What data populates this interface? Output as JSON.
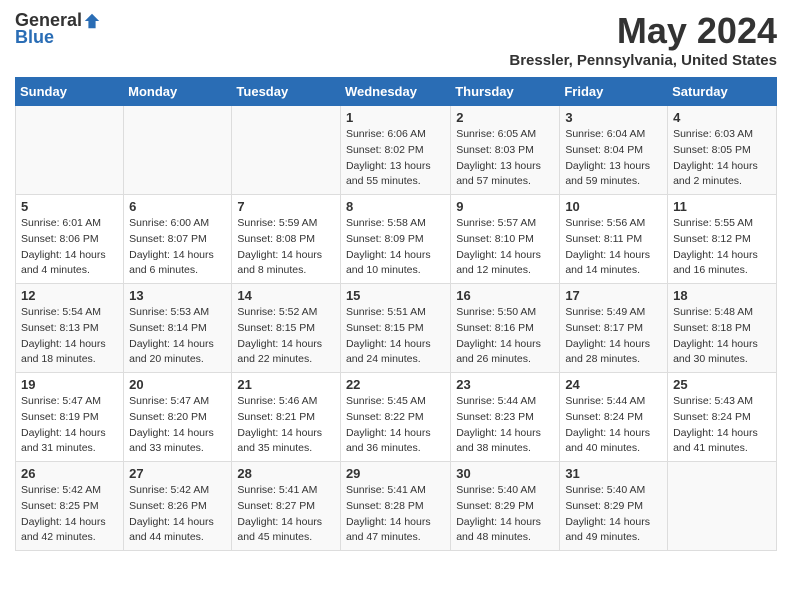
{
  "logo": {
    "general": "General",
    "blue": "Blue"
  },
  "title": "May 2024",
  "location": "Bressler, Pennsylvania, United States",
  "headers": [
    "Sunday",
    "Monday",
    "Tuesday",
    "Wednesday",
    "Thursday",
    "Friday",
    "Saturday"
  ],
  "weeks": [
    [
      {
        "day": "",
        "info": ""
      },
      {
        "day": "",
        "info": ""
      },
      {
        "day": "",
        "info": ""
      },
      {
        "day": "1",
        "info": "Sunrise: 6:06 AM\nSunset: 8:02 PM\nDaylight: 13 hours\nand 55 minutes."
      },
      {
        "day": "2",
        "info": "Sunrise: 6:05 AM\nSunset: 8:03 PM\nDaylight: 13 hours\nand 57 minutes."
      },
      {
        "day": "3",
        "info": "Sunrise: 6:04 AM\nSunset: 8:04 PM\nDaylight: 13 hours\nand 59 minutes."
      },
      {
        "day": "4",
        "info": "Sunrise: 6:03 AM\nSunset: 8:05 PM\nDaylight: 14 hours\nand 2 minutes."
      }
    ],
    [
      {
        "day": "5",
        "info": "Sunrise: 6:01 AM\nSunset: 8:06 PM\nDaylight: 14 hours\nand 4 minutes."
      },
      {
        "day": "6",
        "info": "Sunrise: 6:00 AM\nSunset: 8:07 PM\nDaylight: 14 hours\nand 6 minutes."
      },
      {
        "day": "7",
        "info": "Sunrise: 5:59 AM\nSunset: 8:08 PM\nDaylight: 14 hours\nand 8 minutes."
      },
      {
        "day": "8",
        "info": "Sunrise: 5:58 AM\nSunset: 8:09 PM\nDaylight: 14 hours\nand 10 minutes."
      },
      {
        "day": "9",
        "info": "Sunrise: 5:57 AM\nSunset: 8:10 PM\nDaylight: 14 hours\nand 12 minutes."
      },
      {
        "day": "10",
        "info": "Sunrise: 5:56 AM\nSunset: 8:11 PM\nDaylight: 14 hours\nand 14 minutes."
      },
      {
        "day": "11",
        "info": "Sunrise: 5:55 AM\nSunset: 8:12 PM\nDaylight: 14 hours\nand 16 minutes."
      }
    ],
    [
      {
        "day": "12",
        "info": "Sunrise: 5:54 AM\nSunset: 8:13 PM\nDaylight: 14 hours\nand 18 minutes."
      },
      {
        "day": "13",
        "info": "Sunrise: 5:53 AM\nSunset: 8:14 PM\nDaylight: 14 hours\nand 20 minutes."
      },
      {
        "day": "14",
        "info": "Sunrise: 5:52 AM\nSunset: 8:15 PM\nDaylight: 14 hours\nand 22 minutes."
      },
      {
        "day": "15",
        "info": "Sunrise: 5:51 AM\nSunset: 8:15 PM\nDaylight: 14 hours\nand 24 minutes."
      },
      {
        "day": "16",
        "info": "Sunrise: 5:50 AM\nSunset: 8:16 PM\nDaylight: 14 hours\nand 26 minutes."
      },
      {
        "day": "17",
        "info": "Sunrise: 5:49 AM\nSunset: 8:17 PM\nDaylight: 14 hours\nand 28 minutes."
      },
      {
        "day": "18",
        "info": "Sunrise: 5:48 AM\nSunset: 8:18 PM\nDaylight: 14 hours\nand 30 minutes."
      }
    ],
    [
      {
        "day": "19",
        "info": "Sunrise: 5:47 AM\nSunset: 8:19 PM\nDaylight: 14 hours\nand 31 minutes."
      },
      {
        "day": "20",
        "info": "Sunrise: 5:47 AM\nSunset: 8:20 PM\nDaylight: 14 hours\nand 33 minutes."
      },
      {
        "day": "21",
        "info": "Sunrise: 5:46 AM\nSunset: 8:21 PM\nDaylight: 14 hours\nand 35 minutes."
      },
      {
        "day": "22",
        "info": "Sunrise: 5:45 AM\nSunset: 8:22 PM\nDaylight: 14 hours\nand 36 minutes."
      },
      {
        "day": "23",
        "info": "Sunrise: 5:44 AM\nSunset: 8:23 PM\nDaylight: 14 hours\nand 38 minutes."
      },
      {
        "day": "24",
        "info": "Sunrise: 5:44 AM\nSunset: 8:24 PM\nDaylight: 14 hours\nand 40 minutes."
      },
      {
        "day": "25",
        "info": "Sunrise: 5:43 AM\nSunset: 8:24 PM\nDaylight: 14 hours\nand 41 minutes."
      }
    ],
    [
      {
        "day": "26",
        "info": "Sunrise: 5:42 AM\nSunset: 8:25 PM\nDaylight: 14 hours\nand 42 minutes."
      },
      {
        "day": "27",
        "info": "Sunrise: 5:42 AM\nSunset: 8:26 PM\nDaylight: 14 hours\nand 44 minutes."
      },
      {
        "day": "28",
        "info": "Sunrise: 5:41 AM\nSunset: 8:27 PM\nDaylight: 14 hours\nand 45 minutes."
      },
      {
        "day": "29",
        "info": "Sunrise: 5:41 AM\nSunset: 8:28 PM\nDaylight: 14 hours\nand 47 minutes."
      },
      {
        "day": "30",
        "info": "Sunrise: 5:40 AM\nSunset: 8:29 PM\nDaylight: 14 hours\nand 48 minutes."
      },
      {
        "day": "31",
        "info": "Sunrise: 5:40 AM\nSunset: 8:29 PM\nDaylight: 14 hours\nand 49 minutes."
      },
      {
        "day": "",
        "info": ""
      }
    ]
  ]
}
